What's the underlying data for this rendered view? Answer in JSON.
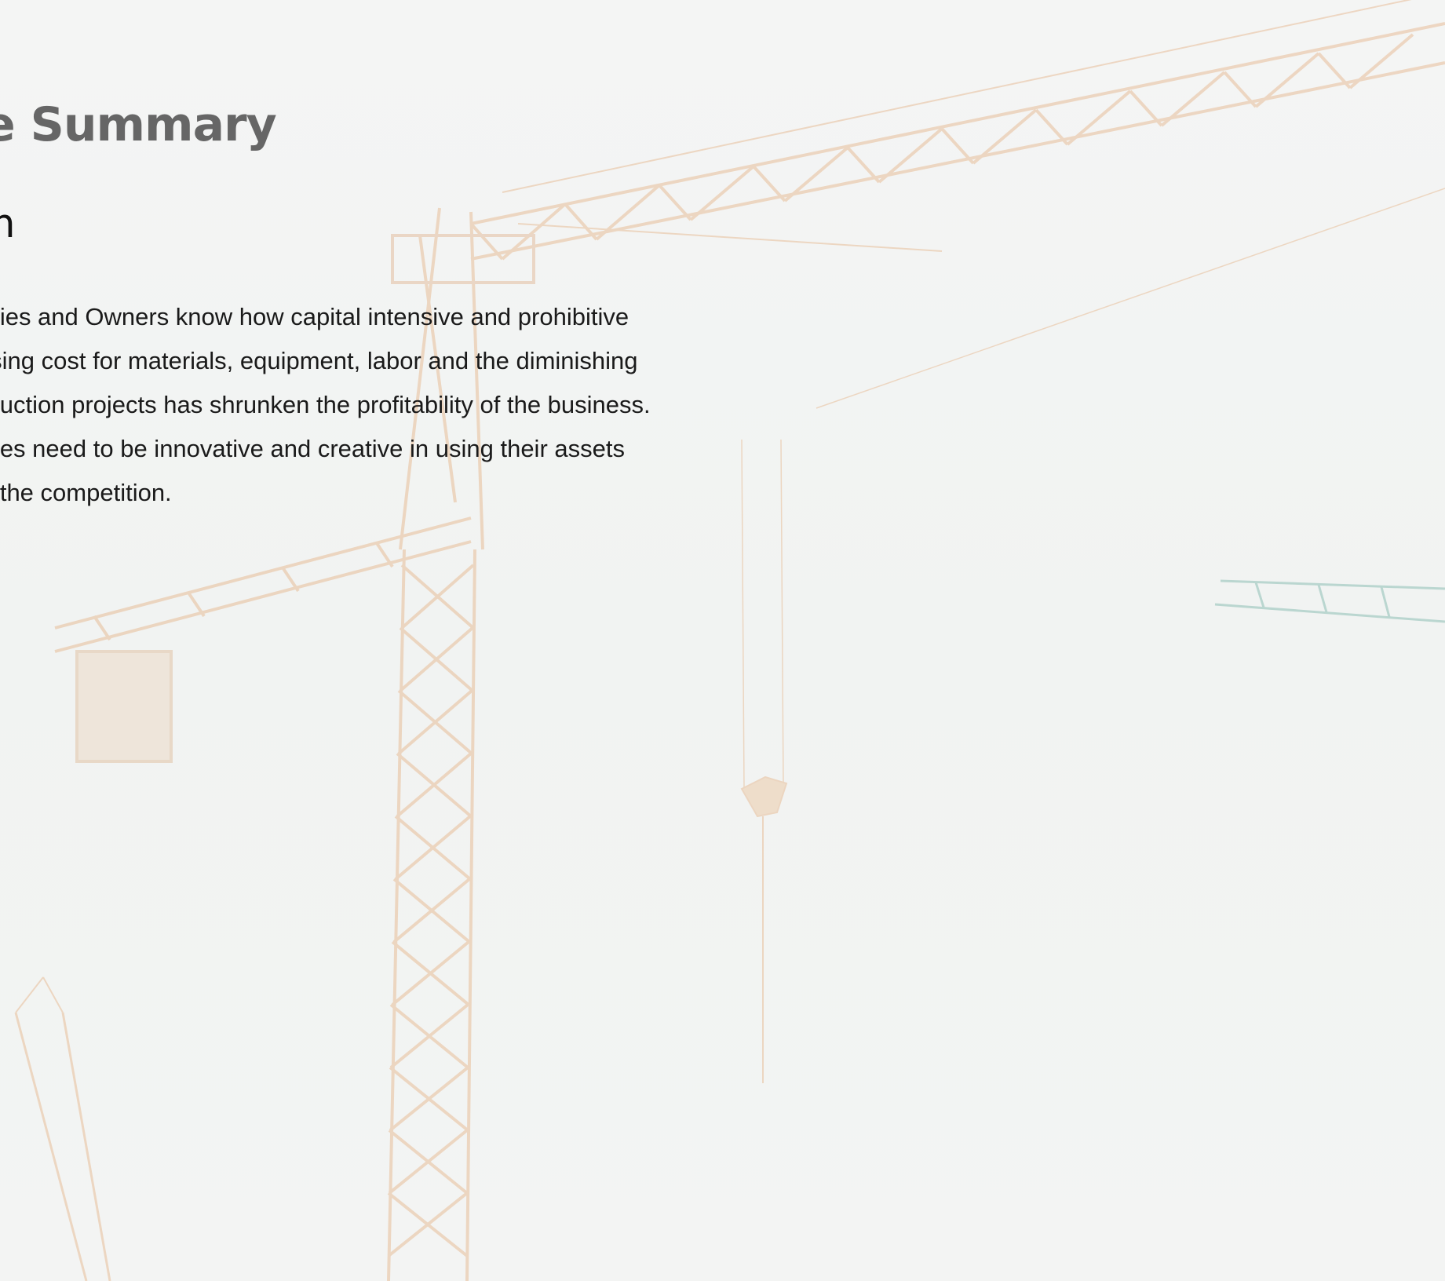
{
  "colors": {
    "background": "#f3f4f3",
    "title": "#666666",
    "heading": "#111111",
    "body": "#1a1a1a",
    "crane": "#e8a868",
    "crane_far": "#6aa89c"
  },
  "background_image": {
    "icon": "tower-crane-photo"
  },
  "section": {
    "title": "Executive Summary",
    "subheading": "The Problem",
    "paragraph_lines": [
      "Construction Companies and Owners know how capital intensive and prohibitive",
      "the industry is. The rising cost for materials, equipment, labor and the diminishing",
      "profit margin of construction projects has shrunken the profitability of the business.",
      "Construction companies need to be innovative and creative in using their assets",
      "and capital to survive the competition."
    ]
  }
}
